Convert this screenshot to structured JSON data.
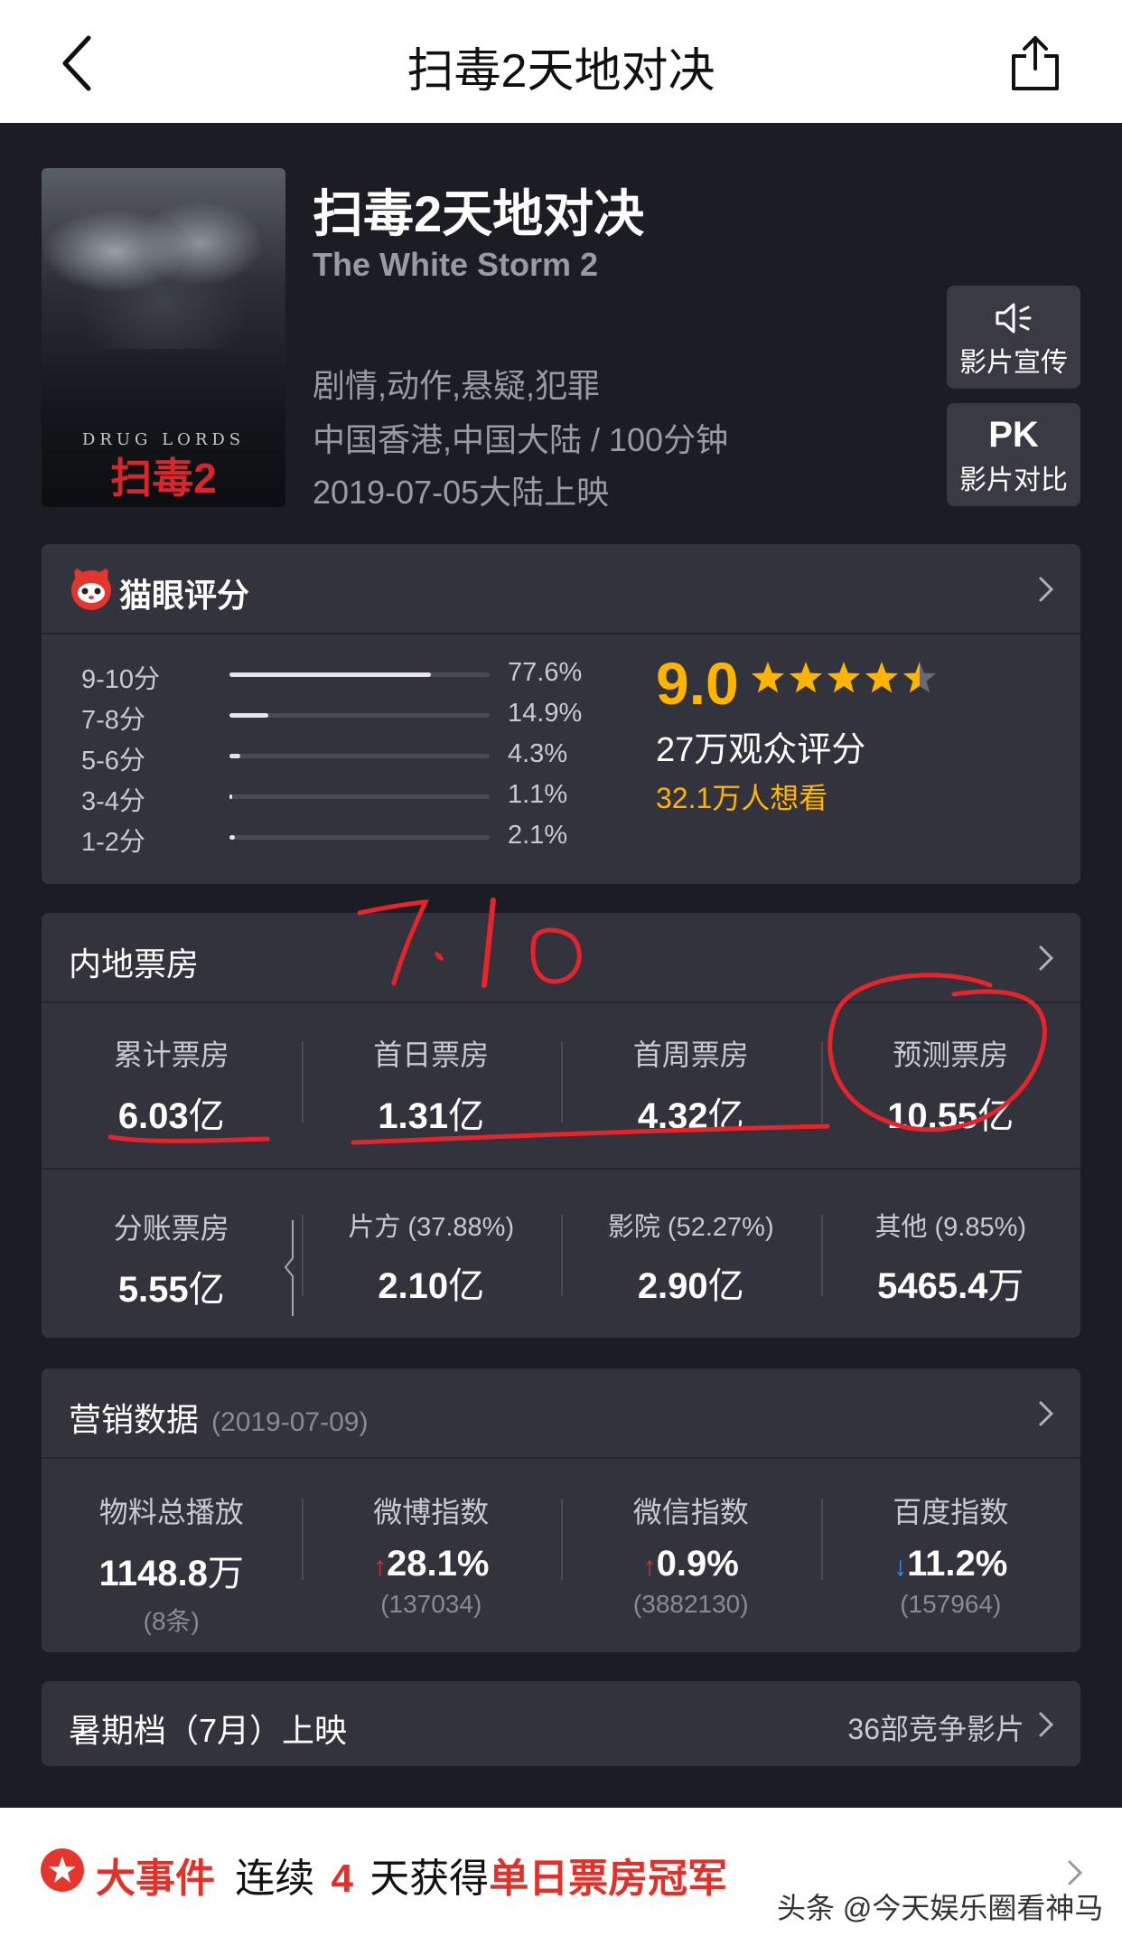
{
  "nav": {
    "title": "扫毒2天地对决"
  },
  "movie": {
    "title_cn": "扫毒2天地对决",
    "title_en": "The White Storm 2",
    "genres": "剧情,动作,悬疑,犯罪",
    "region_duration": "中国香港,中国大陆 / 100分钟",
    "release": "2019-07-05大陆上映",
    "poster": {
      "tagline": "DRUG LORDS",
      "mark": "扫毒2"
    }
  },
  "side_buttons": [
    {
      "icon": "speaker-icon",
      "label": "影片宣传"
    },
    {
      "icon": "PK",
      "label": "影片对比"
    }
  ],
  "rating": {
    "title": "猫眼评分",
    "distribution": [
      {
        "label": "9-10分",
        "pct": "77.6%",
        "value": 77.6
      },
      {
        "label": "7-8分",
        "pct": "14.9%",
        "value": 14.9
      },
      {
        "label": "5-6分",
        "pct": "4.3%",
        "value": 4.3
      },
      {
        "label": "3-4分",
        "pct": "1.1%",
        "value": 1.1
      },
      {
        "label": "1-2分",
        "pct": "2.1%",
        "value": 2.1
      }
    ],
    "score": "9.0",
    "stars": 4.5,
    "votes": "27万观众评分",
    "want": "32.1万人想看",
    "accent": "#ffb400"
  },
  "box_office": {
    "title": "内地票房",
    "top": [
      {
        "key": "累计票房",
        "value": "6.03",
        "unit": "亿"
      },
      {
        "key": "首日票房",
        "value": "1.31",
        "unit": "亿"
      },
      {
        "key": "首周票房",
        "value": "4.32",
        "unit": "亿"
      },
      {
        "key": "预测票房",
        "value": "10.55",
        "unit": "亿"
      }
    ],
    "split": [
      {
        "key": "分账票房",
        "value": "5.55",
        "unit": "亿"
      },
      {
        "key": "片方 (37.88%)",
        "value": "2.10",
        "unit": "亿"
      },
      {
        "key": "影院 (52.27%)",
        "value": "2.90",
        "unit": "亿"
      },
      {
        "key": "其他 (9.85%)",
        "value": "5465.4",
        "unit": "万"
      }
    ],
    "handwriting": "7.10"
  },
  "marketing": {
    "title": "营销数据",
    "date": "(2019-07-09)",
    "items": [
      {
        "key": "物料总播放",
        "value": "1148.8",
        "unit": "万",
        "sub": "(8条)",
        "trend": ""
      },
      {
        "key": "微博指数",
        "value": "28.1%",
        "unit": "",
        "sub": "(137034)",
        "trend": "up"
      },
      {
        "key": "微信指数",
        "value": "0.9%",
        "unit": "",
        "sub": "(3882130)",
        "trend": "up"
      },
      {
        "key": "百度指数",
        "value": "11.2%",
        "unit": "",
        "sub": "(157964)",
        "trend": "down"
      }
    ]
  },
  "summer": {
    "label": "暑期档（7月）上映",
    "count": "36部竞争影片"
  },
  "banner": {
    "tag": "大事件",
    "pre": "连续",
    "num": "4",
    "mid": "天获得",
    "highlight": "单日票房冠军",
    "watermark": "头条 @今天娱乐圈看神马"
  }
}
